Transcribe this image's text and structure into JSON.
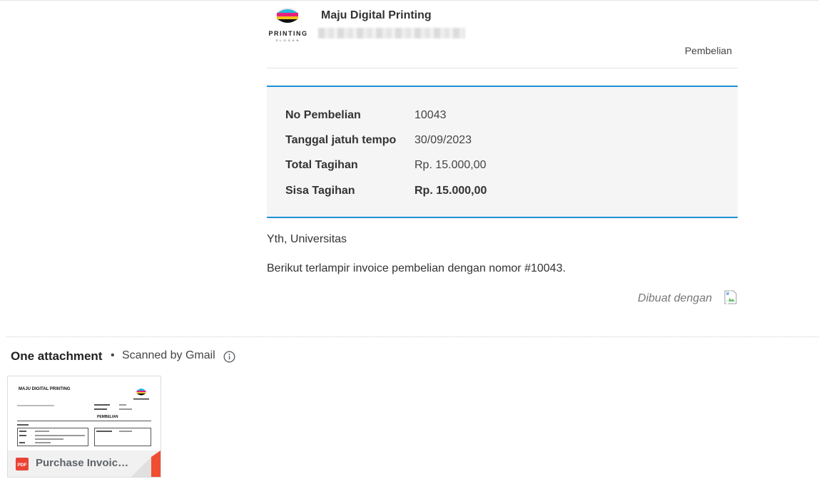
{
  "email": {
    "company_name": "Maju Digital Printing",
    "logo_text": "PRINTING",
    "logo_slogan": "SLOGAN",
    "document_type": "Pembelian",
    "summary": [
      {
        "label": "No Pembelian",
        "value": "10043"
      },
      {
        "label": "Tanggal jatuh tempo",
        "value": "30/09/2023"
      },
      {
        "label": "Total Tagihan",
        "value": "Rp. 15.000,00"
      },
      {
        "label": "Sisa Tagihan",
        "value": "Rp. 15.000,00"
      }
    ],
    "greeting": "Yth, Universitas",
    "message": "Berikut terlampir invoice pembelian dengan nomor #10043.",
    "made_with": "Dibuat dengan"
  },
  "attachments": {
    "title": "One attachment",
    "separator": "•",
    "scanned_text": "Scanned by Gmail",
    "files": [
      {
        "name": "Purchase Invoice...",
        "type_badge": "PDF",
        "preview_title": "MAJU DIGITAL PRINTING",
        "preview_heading": "PEMBELIAN"
      }
    ]
  },
  "colors": {
    "accent_border": "#1e90d6",
    "pdf_red": "#ea4335"
  }
}
